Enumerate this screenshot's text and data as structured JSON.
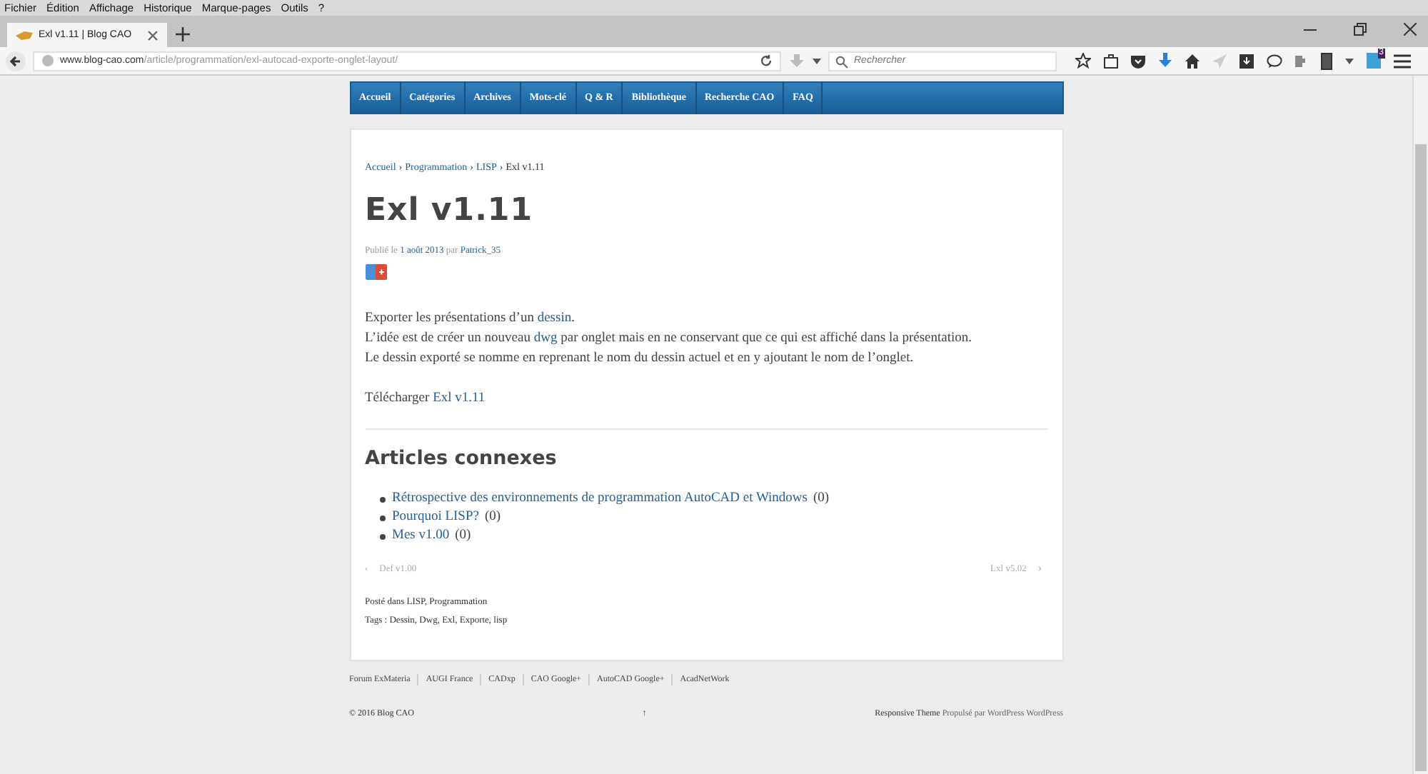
{
  "menu_bar": [
    "Fichier",
    "Édition",
    "Affichage",
    "Historique",
    "Marque-pages",
    "Outils",
    "?"
  ],
  "tab": {
    "title": "Exl v1.11 | Blog CAO",
    "selected": true
  },
  "address_bar": {
    "host": "www.blog-cao.com",
    "path": "/article/programmation/exl-autocad-exporte-onglet-layout/"
  },
  "search": {
    "placeholder": "Rechercher"
  },
  "extension_badge": "3",
  "site_nav": [
    "Accueil",
    "Catégories",
    "Archives",
    "Mots-clé",
    "Q & R",
    "Bibliothèque",
    "Recherche CAO",
    "FAQ"
  ],
  "breadcrumb": {
    "links": [
      "Accueil",
      "Programmation",
      "LISP"
    ],
    "separator": "›",
    "current": "Exl v1.11"
  },
  "article": {
    "title": "Exl v1.11",
    "meta": [
      {
        "text": "Publié le "
      },
      {
        "link": "1 août 2013"
      },
      {
        "text": " par "
      },
      {
        "link": "Patrick_35"
      }
    ],
    "paragraphs": [
      [
        {
          "text": "Exporter les présentations d’un "
        },
        {
          "link": "dessin"
        },
        {
          "text": "."
        }
      ],
      [
        {
          "text": "L’idée est de créer un nouveau "
        },
        {
          "link": "dwg"
        },
        {
          "text": " par onglet mais en ne conservant que ce qui est affiché dans la présentation."
        }
      ],
      [
        {
          "text": "Le dessin exporté se nomme en reprenant le nom du dessin actuel et en y ajoutant le nom de l’onglet."
        }
      ]
    ],
    "download": [
      {
        "text": "Télécharger "
      },
      {
        "link": "Exl v1.11"
      }
    ]
  },
  "related": {
    "title": "Articles connexes",
    "items": [
      {
        "link": "Rétrospective des environnements de programmation AutoCAD et Windows",
        "count": "(0)"
      },
      {
        "link": "Pourquoi LISP?",
        "count": "(0)"
      },
      {
        "link": "Mes v1.00",
        "count": "(0)"
      }
    ]
  },
  "post_nav": {
    "previous": {
      "arrow": "‹",
      "label": "Def v1.00"
    },
    "next": {
      "label": "Lxl v5.02",
      "arrow": "›"
    }
  },
  "posted_in": "Posté dans LISP, Programmation",
  "tags": "Tags : Dessin, Dwg, Exl, Exporte, lisp",
  "footer_links": [
    "Forum ExMateria",
    "AUGI France",
    "CADxp",
    "CAO Google+",
    "AutoCAD Google+",
    "AcadNetWork"
  ],
  "footer": {
    "copyright": "© 2016 Blog CAO",
    "top_arrow": "↑",
    "credit": [
      {
        "strong": "Responsive Theme"
      },
      {
        "text": " Propulsé par WordPress WordPress"
      }
    ]
  }
}
